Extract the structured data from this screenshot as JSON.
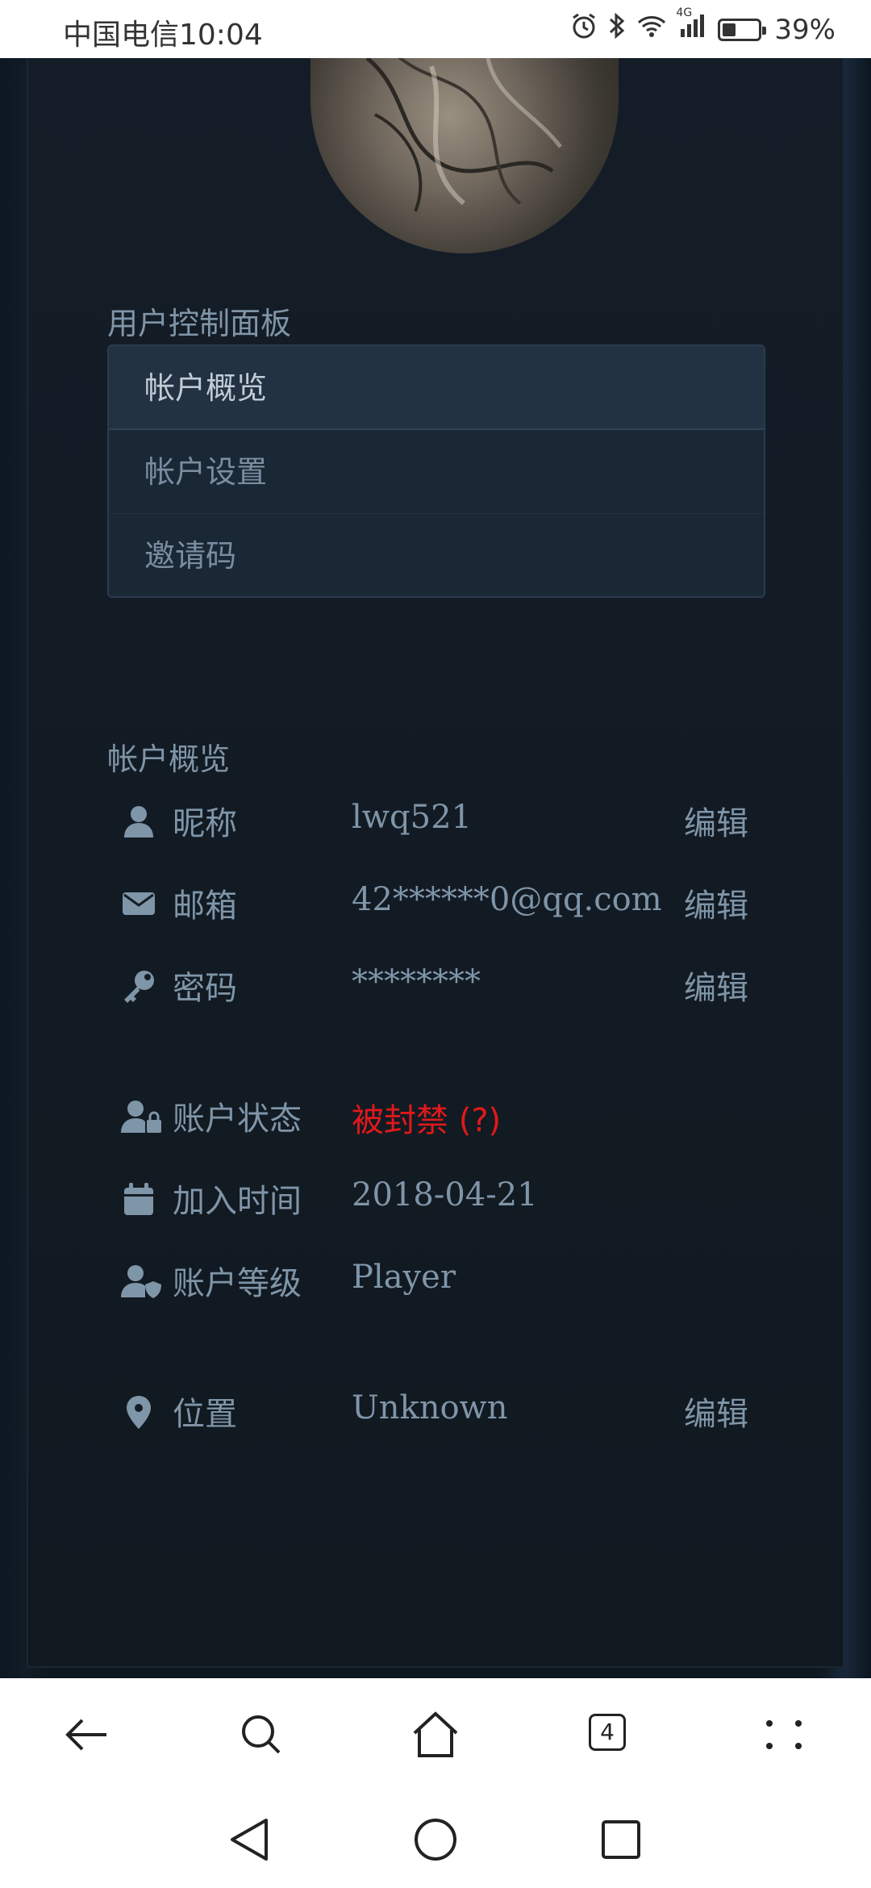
{
  "status_bar": {
    "carrier_time": "中国电信10:04",
    "network_label": "4G",
    "battery_text": "39%",
    "battery_level": 0.39,
    "icons": [
      "alarm-icon",
      "bluetooth-icon",
      "wifi-icon",
      "signal-icon",
      "battery-icon"
    ]
  },
  "control_panel": {
    "title": "用户控制面板",
    "menu": [
      {
        "label": "帐户概览",
        "active": true
      },
      {
        "label": "帐户设置",
        "active": false
      },
      {
        "label": "邀请码",
        "active": false
      }
    ]
  },
  "overview": {
    "title": "帐户概览",
    "rows": [
      {
        "icon": "user-icon",
        "label": "昵称",
        "value": "lwq521",
        "action": "编辑"
      },
      {
        "icon": "envelope-icon",
        "label": "邮箱",
        "value": "42******0@qq.com",
        "action": "编辑"
      },
      {
        "icon": "key-icon",
        "label": "密码",
        "value": "********",
        "action": "编辑"
      },
      {
        "icon": "user-lock-icon",
        "label": "账户状态",
        "value": "被封禁 (?)",
        "value_color": "#e0191b"
      },
      {
        "icon": "calendar-icon",
        "label": "加入时间",
        "value": "2018-04-21"
      },
      {
        "icon": "user-shield-icon",
        "label": "账户等级",
        "value": "Player"
      },
      {
        "icon": "map-marker-icon",
        "label": "位置",
        "value": "Unknown",
        "action": "编辑"
      }
    ]
  },
  "browser_toolbar": {
    "tab_count": "4",
    "icons": [
      "back-arrow-icon",
      "search-icon",
      "home-icon",
      "tabs-icon",
      "more-icon"
    ]
  },
  "nav_bar": {
    "icons": [
      "nav-back-icon",
      "nav-home-icon",
      "nav-recents-icon"
    ]
  },
  "colors": {
    "accent_text": "#7f95a8",
    "banned": "#e0191b",
    "panel_bg": "#141d27"
  }
}
